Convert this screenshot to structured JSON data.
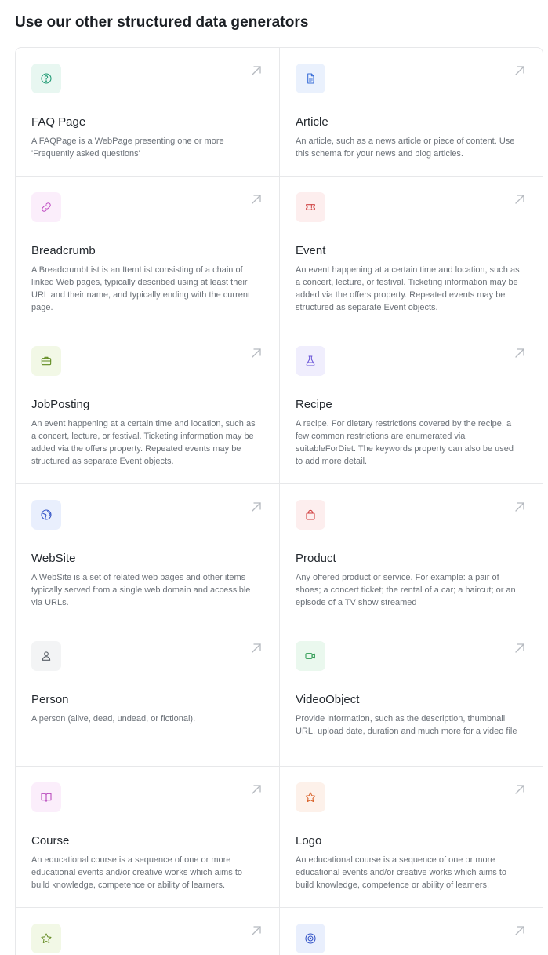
{
  "heading": "Use our other structured data generators",
  "cards": [
    {
      "title": "FAQ Page",
      "icon": "question-circle-icon",
      "bg": "#e8f7f1",
      "fg": "#1f9a73",
      "desc": "A FAQPage is a WebPage presenting one or more 'Frequently asked questions'"
    },
    {
      "title": "Article",
      "icon": "document-icon",
      "bg": "#eaf1fd",
      "fg": "#3b6fd8",
      "desc": "An article, such as a news article or piece of content. Use this schema for your news and blog articles."
    },
    {
      "title": "Breadcrumb",
      "icon": "link-icon",
      "bg": "#fbeefb",
      "fg": "#c14fc4",
      "desc": "A BreadcrumbList is an ItemList consisting of a chain of linked Web pages, typically described using at least their URL and their name, and typically ending with the current page."
    },
    {
      "title": "Event",
      "icon": "ticket-icon",
      "bg": "#fdeeee",
      "fg": "#d04646",
      "desc": "An event happening at a certain time and location, such as a concert, lecture, or festival. Ticketing information may be added via the offers property. Repeated events may be structured as separate Event objects."
    },
    {
      "title": "JobPosting",
      "icon": "briefcase-icon",
      "bg": "#f2f8e6",
      "fg": "#5f8a1e",
      "desc": "An event happening at a certain time and location, such as a concert, lecture, or festival. Ticketing information may be added via the offers property. Repeated events may be structured as separate Event objects."
    },
    {
      "title": "Recipe",
      "icon": "flask-icon",
      "bg": "#f0eefd",
      "fg": "#6a55d8",
      "desc": "A recipe. For dietary restrictions covered by the recipe, a few common restrictions are enumerated via suitableForDiet. The keywords property can also be used to add more detail."
    },
    {
      "title": "WebSite",
      "icon": "globe-icon",
      "bg": "#e9effd",
      "fg": "#3454c7",
      "desc": "A WebSite is a set of related web pages and other items typically served from a single web domain and accessible via URLs."
    },
    {
      "title": "Product",
      "icon": "shopping-bag-icon",
      "bg": "#fdeeee",
      "fg": "#d03b3b",
      "desc": "Any offered product or service. For example: a pair of shoes; a concert ticket; the rental of a car; a haircut; or an episode of a TV show streamed"
    },
    {
      "title": "Person",
      "icon": "user-icon",
      "bg": "#f3f4f5",
      "fg": "#5a6068",
      "desc": "A person (alive, dead, undead, or fictional)."
    },
    {
      "title": "VideoObject",
      "icon": "video-camera-icon",
      "bg": "#eaf8ee",
      "fg": "#2c9a51",
      "desc": "Provide information, such as the description, thumbnail URL, upload date, duration and much more for a video file"
    },
    {
      "title": "Course",
      "icon": "book-open-icon",
      "bg": "#fbeefb",
      "fg": "#b94bbd",
      "desc": "An educational course is a sequence of one or more educational events and/or creative works which aims to build knowledge, competence or ability of learners."
    },
    {
      "title": "Logo",
      "icon": "star-icon",
      "bg": "#fdf1ea",
      "fg": "#d9622a",
      "desc": "An educational course is a sequence of one or more educational events and/or creative works which aims to build knowledge, competence or ability of learners."
    },
    {
      "title": "",
      "icon": "star-icon",
      "bg": "#f2f8e6",
      "fg": "#6a8f2a",
      "desc": ""
    },
    {
      "title": "",
      "icon": "target-icon",
      "bg": "#e9effd",
      "fg": "#3454c7",
      "desc": ""
    }
  ]
}
